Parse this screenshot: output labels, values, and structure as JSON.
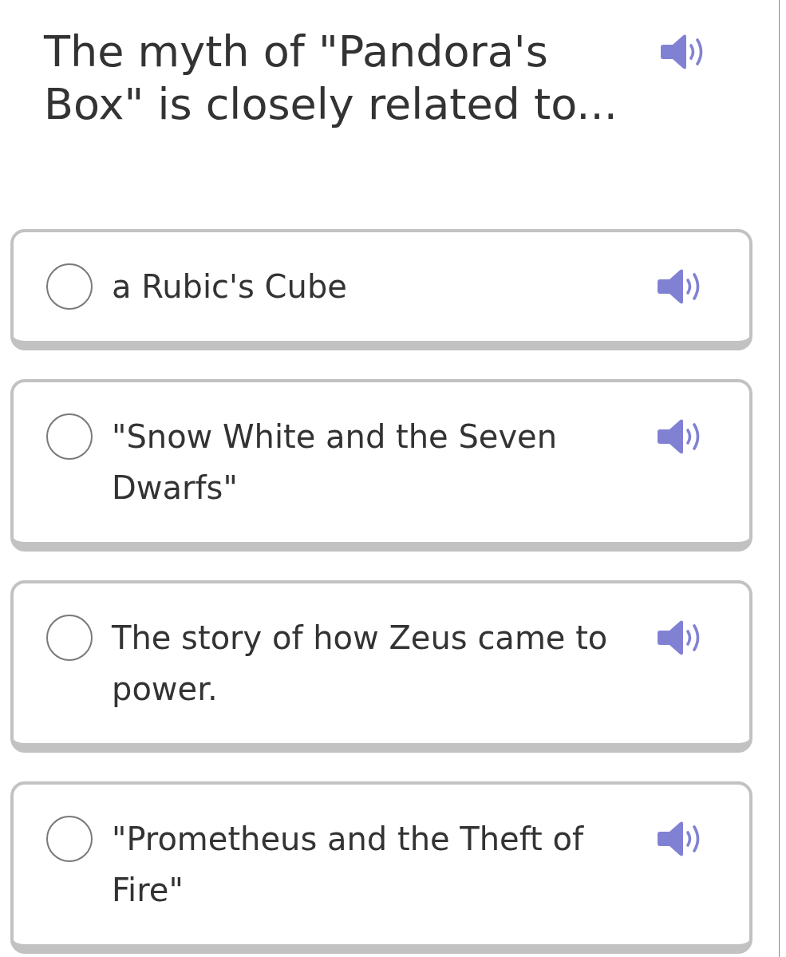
{
  "question": {
    "text": "The myth of \"Pandora's Box\" is closely related to..."
  },
  "options": [
    {
      "text": "a Rubic's Cube",
      "selected": false
    },
    {
      "text": "\"Snow White and the Seven Dwarfs\"",
      "selected": false
    },
    {
      "text": "The story of how Zeus came to power.",
      "selected": false
    },
    {
      "text": "\"Prometheus and the Theft of Fire\"",
      "selected": false
    }
  ]
}
